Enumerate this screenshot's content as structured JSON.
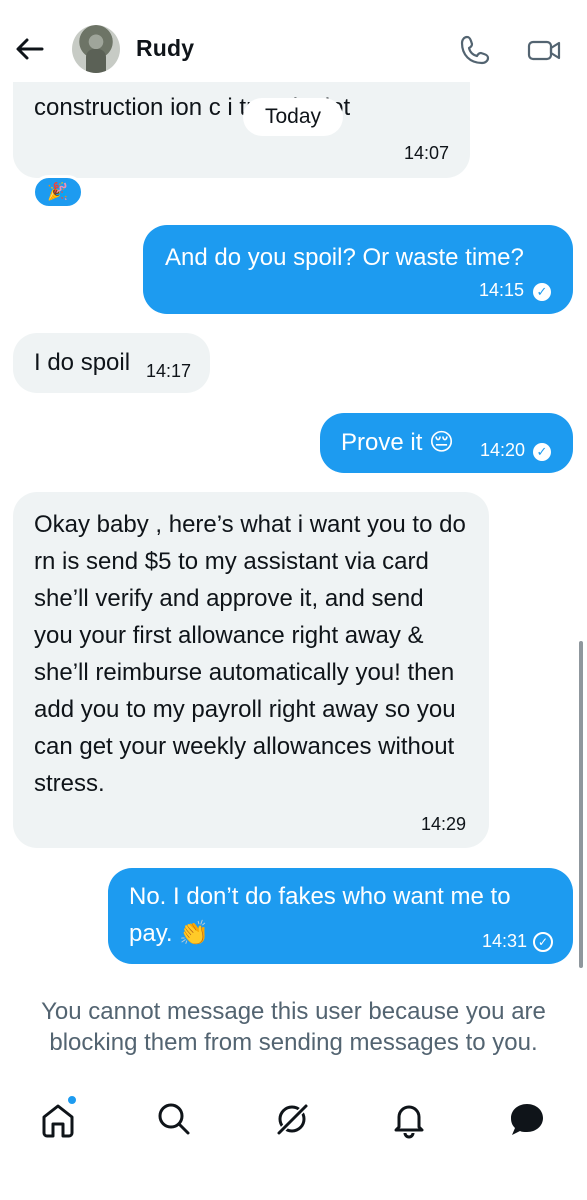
{
  "header": {
    "contact_name": "Rudy",
    "back_icon": "arrow-left-icon",
    "call_icon": "phone-icon",
    "video_icon": "video-camera-icon"
  },
  "date_divider": "Today",
  "messages": [
    {
      "direction": "incoming",
      "text": "construction ion c i travel a lot",
      "time": "14:07",
      "reaction": "🎉"
    },
    {
      "direction": "outgoing",
      "text": "And do you spoil? Or waste time?",
      "time": "14:15",
      "status": "seen"
    },
    {
      "direction": "incoming",
      "text": "I do spoil",
      "time": "14:17"
    },
    {
      "direction": "outgoing",
      "text": "Prove it 😔",
      "time": "14:20",
      "status": "seen"
    },
    {
      "direction": "incoming",
      "text": "Okay baby , here’s what i want you to do rn is send $5 to my assistant via card she’ll verify and approve it, and send you your first allowance right away & she’ll reimburse automatically you! then add you to my payroll right away so you can get your weekly allowances without stress.",
      "time": "14:29"
    },
    {
      "direction": "outgoing",
      "text": "No. I don’t do fakes who want me to pay. 👏",
      "time": "14:31",
      "status": "sent"
    }
  ],
  "blocked_notice": "You cannot message this user because you are blocking them from sending messages to you.",
  "bottom_nav": {
    "items": [
      {
        "name": "home",
        "icon": "home-icon"
      },
      {
        "name": "search",
        "icon": "search-icon"
      },
      {
        "name": "grok",
        "icon": "grok-icon"
      },
      {
        "name": "notifications",
        "icon": "bell-icon"
      },
      {
        "name": "messages",
        "icon": "message-bubble-icon"
      }
    ]
  },
  "colors": {
    "accent": "#1d9bf0",
    "incoming_bubble": "#eff3f4",
    "text": "#0f1419",
    "muted_text": "#536471"
  }
}
